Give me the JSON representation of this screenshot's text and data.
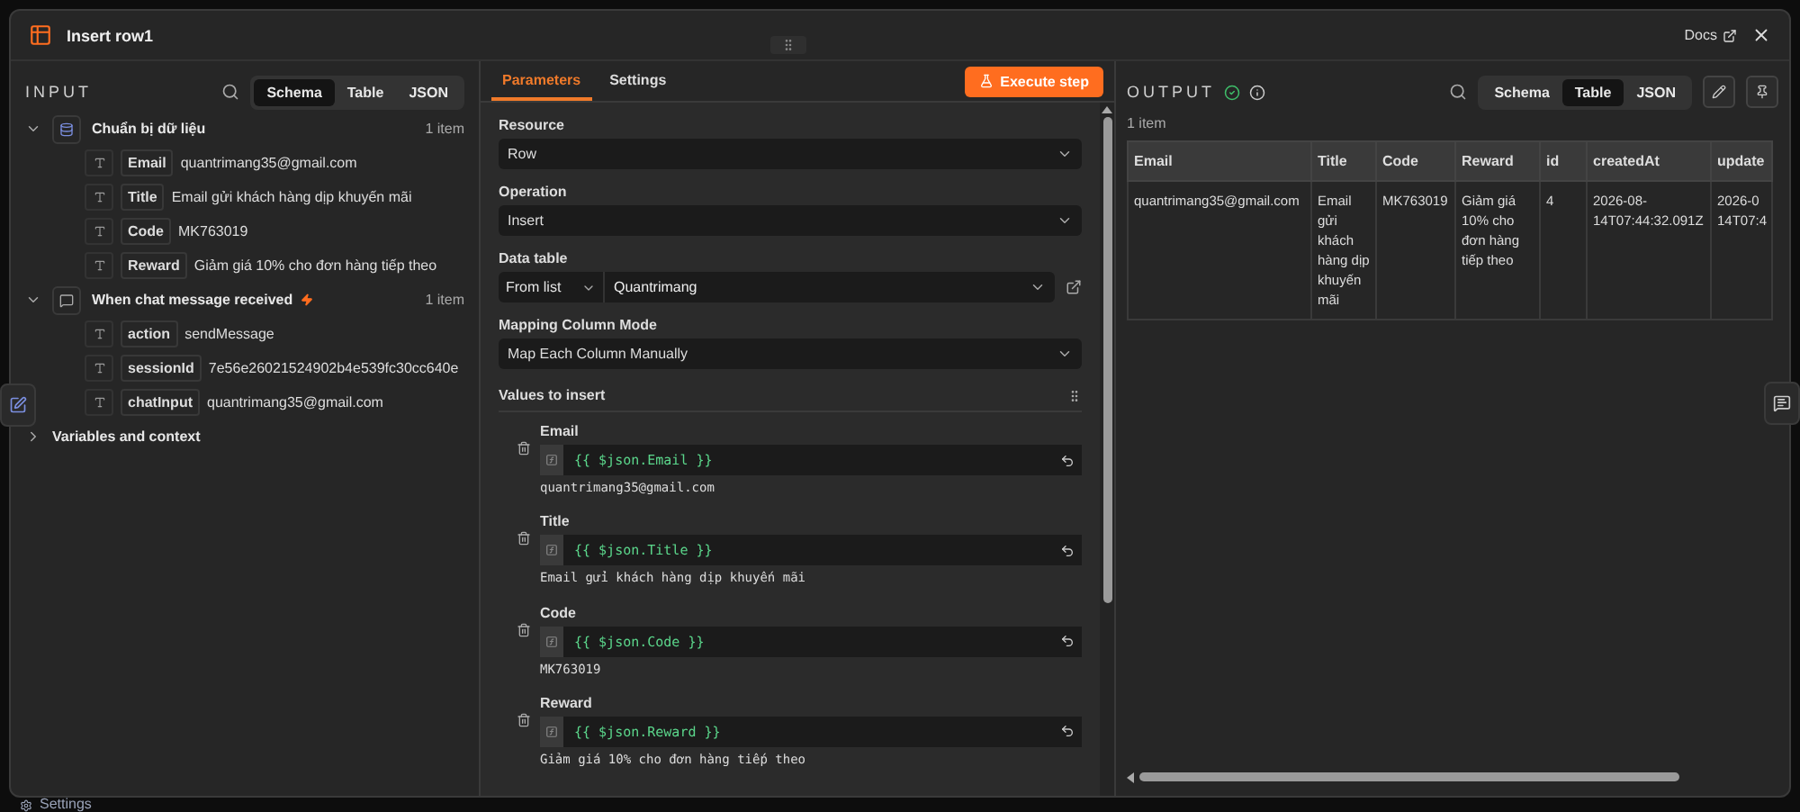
{
  "window": {
    "title": "Insert row1",
    "docs_link": "Docs"
  },
  "input": {
    "title": "INPUT",
    "view_tabs": [
      {
        "label": "Schema",
        "selected": true
      },
      {
        "label": "Table",
        "selected": false
      },
      {
        "label": "JSON",
        "selected": false
      }
    ],
    "nodes": [
      {
        "kind": "data",
        "name": "Chuẩn bị dữ liệu",
        "count": "1 item",
        "expanded": true,
        "trigger": false,
        "fields": [
          {
            "key": "Email",
            "value": "quantrimang35@gmail.com"
          },
          {
            "key": "Title",
            "value": "Email gửi khách hàng dịp khuyến mãi"
          },
          {
            "key": "Code",
            "value": "MK763019"
          },
          {
            "key": "Reward",
            "value": "Giảm giá 10% cho đơn hàng tiếp theo"
          }
        ]
      },
      {
        "kind": "chat",
        "name": "When chat message received",
        "count": "1 item",
        "expanded": true,
        "trigger": true,
        "fields": [
          {
            "key": "action",
            "value": "sendMessage"
          },
          {
            "key": "sessionId",
            "value": "7e56e26021524902b4e539fc30cc640e"
          },
          {
            "key": "chatInput",
            "value": "quantrimang35@gmail.com"
          }
        ]
      },
      {
        "kind": "context",
        "name": "Variables and context",
        "expanded": false,
        "trigger": false
      }
    ]
  },
  "parameters": {
    "tabs": [
      {
        "label": "Parameters",
        "selected": true
      },
      {
        "label": "Settings",
        "selected": false
      }
    ],
    "execute_button": "Execute step",
    "fields": [
      {
        "kind": "select",
        "label": "Resource",
        "value": "Row"
      },
      {
        "kind": "select",
        "label": "Operation",
        "value": "Insert"
      },
      {
        "kind": "list",
        "label": "Data table",
        "mode": "From list",
        "table": "Quantrimang"
      },
      {
        "kind": "select",
        "label": "Mapping Column Mode",
        "value": "Map Each Column Manually"
      }
    ],
    "values_label": "Values to insert",
    "values": [
      {
        "name": "Email",
        "expression": "{{ $json.Email }}",
        "result": "quantrimang35@gmail.com"
      },
      {
        "name": "Title",
        "expression": "{{ $json.Title }}",
        "result": "Email gửi khách hàng dịp khuyến mãi"
      },
      {
        "name": "Code",
        "expression": "{{ $json.Code }}",
        "result": "MK763019"
      },
      {
        "name": "Reward",
        "expression": "{{ $json.Reward }}",
        "result": "Giảm giá 10% cho đơn hàng tiếp theo"
      }
    ]
  },
  "output": {
    "title": "OUTPUT",
    "success": true,
    "view_tabs": [
      {
        "label": "Schema",
        "selected": false
      },
      {
        "label": "Table",
        "selected": true
      },
      {
        "label": "JSON",
        "selected": false
      }
    ],
    "count": "1 item",
    "table": {
      "columns": [
        "Email",
        "Title",
        "Code",
        "Reward",
        "id",
        "createdAt",
        "update"
      ],
      "rows": [
        [
          "quantrimang35@gmail.com",
          "Email gửi khách hàng dịp khuyến mãi",
          "MK763019",
          "Giảm giá 10% cho đơn hàng tiếp theo",
          "4",
          "2026-08-14T07:44:32.091Z",
          "2026-0\n14T07:4"
        ]
      ]
    }
  },
  "background": {
    "settings": "Settings"
  }
}
